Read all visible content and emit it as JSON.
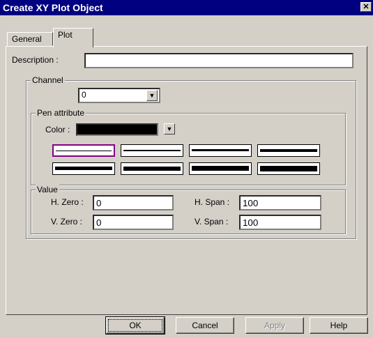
{
  "window": {
    "title": "Create XY Plot Object",
    "close_glyph": "✕"
  },
  "tabs": [
    {
      "label": "General"
    },
    {
      "label": "Plot"
    }
  ],
  "description": {
    "label": "Description :",
    "value": ""
  },
  "channel": {
    "group_label": "Channel",
    "value": "0"
  },
  "pen": {
    "group_label": "Pen attribute",
    "color_label": "Color :",
    "color_value": "#000000",
    "styles_selected_index": 0
  },
  "value": {
    "group_label": "Value",
    "h_zero_label": "H. Zero :",
    "h_zero": "0",
    "h_span_label": "H. Span :",
    "h_span": "100",
    "v_zero_label": "V. Zero :",
    "v_zero": "0",
    "v_span_label": "V. Span :",
    "v_span": "100"
  },
  "buttons": {
    "ok": "OK",
    "cancel": "Cancel",
    "apply": "Apply",
    "help": "Help"
  }
}
